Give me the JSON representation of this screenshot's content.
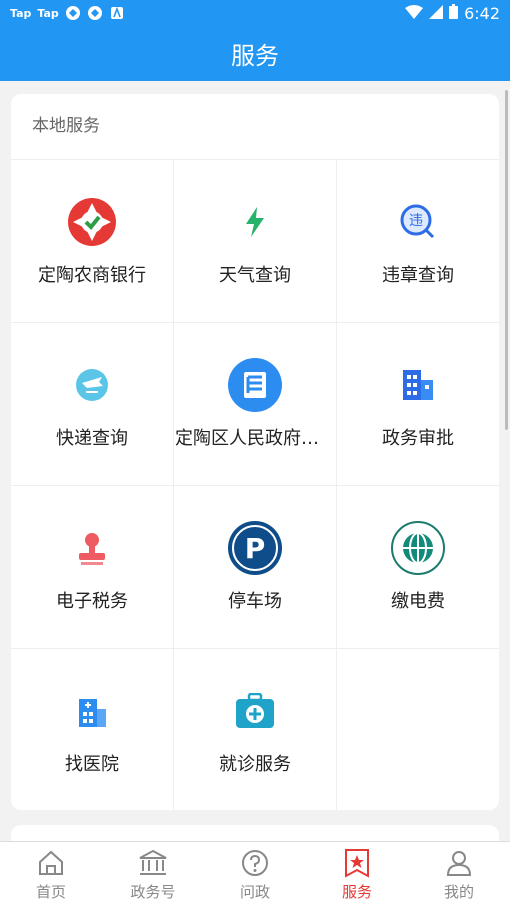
{
  "status_bar": {
    "left_texts": [
      "Tap",
      "Tap"
    ],
    "time": "6:42"
  },
  "header": {
    "title": "服务"
  },
  "local_services": {
    "section_title": "本地服务",
    "items": [
      {
        "label": "定陶农商银行",
        "icon": "bank-logo-icon"
      },
      {
        "label": "天气查询",
        "icon": "lightning-icon"
      },
      {
        "label": "违章查询",
        "icon": "violation-search-icon"
      },
      {
        "label": "快递查询",
        "icon": "express-delivery-icon"
      },
      {
        "label": "定陶区人民政府官…",
        "icon": "government-site-icon"
      },
      {
        "label": "政务审批",
        "icon": "buildings-icon"
      },
      {
        "label": "电子税务",
        "icon": "stamp-icon"
      },
      {
        "label": "停车场",
        "icon": "parking-icon"
      },
      {
        "label": "缴电费",
        "icon": "state-grid-logo-icon"
      },
      {
        "label": "找医院",
        "icon": "hospital-icon"
      },
      {
        "label": "就诊服务",
        "icon": "medical-kit-icon"
      },
      {
        "label": "",
        "icon": ""
      }
    ]
  },
  "tab_bar": {
    "tabs": [
      {
        "label": "首页",
        "icon": "home-icon"
      },
      {
        "label": "政务号",
        "icon": "institution-icon"
      },
      {
        "label": "问政",
        "icon": "question-icon"
      },
      {
        "label": "服务",
        "icon": "service-star-icon",
        "active": true
      },
      {
        "label": "我的",
        "icon": "user-icon"
      }
    ]
  },
  "colors": {
    "primary": "#2196f3",
    "active_tab": "#e53935"
  }
}
